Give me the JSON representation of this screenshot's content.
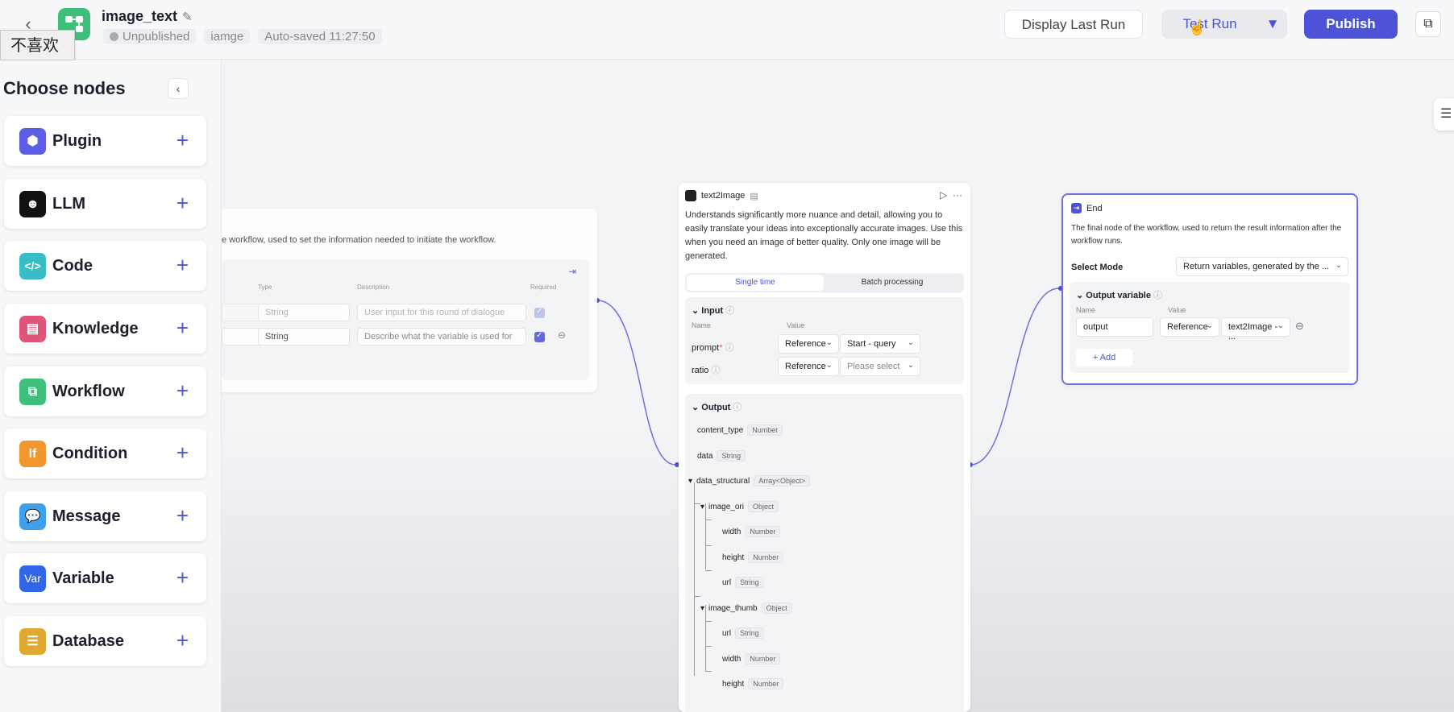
{
  "header": {
    "title": "image_text",
    "status": "Unpublished",
    "tag": "iamge",
    "autosave": "Auto-saved 11:27:50",
    "tooltip": "不喜欢",
    "display_last_run": "Display Last Run",
    "test_run": "Test Run",
    "publish": "Publish"
  },
  "sidebar": {
    "title": "Choose nodes",
    "items": [
      {
        "label": "Plugin",
        "color": "#5b5fe6"
      },
      {
        "label": "LLM",
        "color": "#111111"
      },
      {
        "label": "Code",
        "color": "#38bdc4"
      },
      {
        "label": "Knowledge",
        "color": "#e0567a"
      },
      {
        "label": "Workflow",
        "color": "#3ec07a"
      },
      {
        "label": "Condition",
        "color": "#f0982e",
        "glyph": "If"
      },
      {
        "label": "Message",
        "color": "#3ea0ea"
      },
      {
        "label": "Variable",
        "color": "#3266e6",
        "glyph": "Var"
      },
      {
        "label": "Database",
        "color": "#e0a830"
      }
    ]
  },
  "start_node": {
    "description": "e workflow, used to set the information needed to initiate the workflow.",
    "col_type": "Type",
    "col_description": "Description",
    "col_required": "Required",
    "row1_type": "String",
    "row1_desc_placeholder": "User input for this round of dialogue",
    "row2_type": "String",
    "row2_desc_placeholder": "Describe what the variable is used for"
  },
  "text2image": {
    "title": "text2Image",
    "description": "Understands significantly more nuance and detail, allowing you to easily translate your ideas into exceptionally accurate images. Use this when you need an image of better quality. Only one image will be generated.",
    "tab_single": "Single time",
    "tab_batch": "Batch processing",
    "input_title": "Input",
    "col_name": "Name",
    "col_value": "Value",
    "inputs": [
      {
        "name": "prompt",
        "type": "Reference",
        "value": "Start - query"
      },
      {
        "name": "ratio",
        "type": "Reference",
        "value": "Please select"
      }
    ],
    "output_title": "Output",
    "outputs": [
      {
        "name": "content_type",
        "type": "Number"
      },
      {
        "name": "data",
        "type": "String"
      },
      {
        "name": "data_structural",
        "type": "Array<Object>"
      },
      {
        "name": "image_ori",
        "type": "Object"
      },
      {
        "name": "width",
        "type": "Number"
      },
      {
        "name": "height",
        "type": "Number"
      },
      {
        "name": "url",
        "type": "String"
      },
      {
        "name": "image_thumb",
        "type": "Object"
      },
      {
        "name": "url",
        "type": "String"
      },
      {
        "name": "width",
        "type": "Number"
      },
      {
        "name": "height",
        "type": "Number"
      }
    ]
  },
  "end_node": {
    "title": "End",
    "description": "The final node of the workflow, used to return the result information after the workflow runs.",
    "select_mode_label": "Select Mode",
    "select_mode_value": "Return variables, generated by the ...",
    "output_variable_title": "Output variable",
    "col_name": "Name",
    "col_value": "Value",
    "var_name": "output",
    "var_type": "Reference",
    "var_value": "text2Image - ...",
    "add_label": "Add"
  }
}
